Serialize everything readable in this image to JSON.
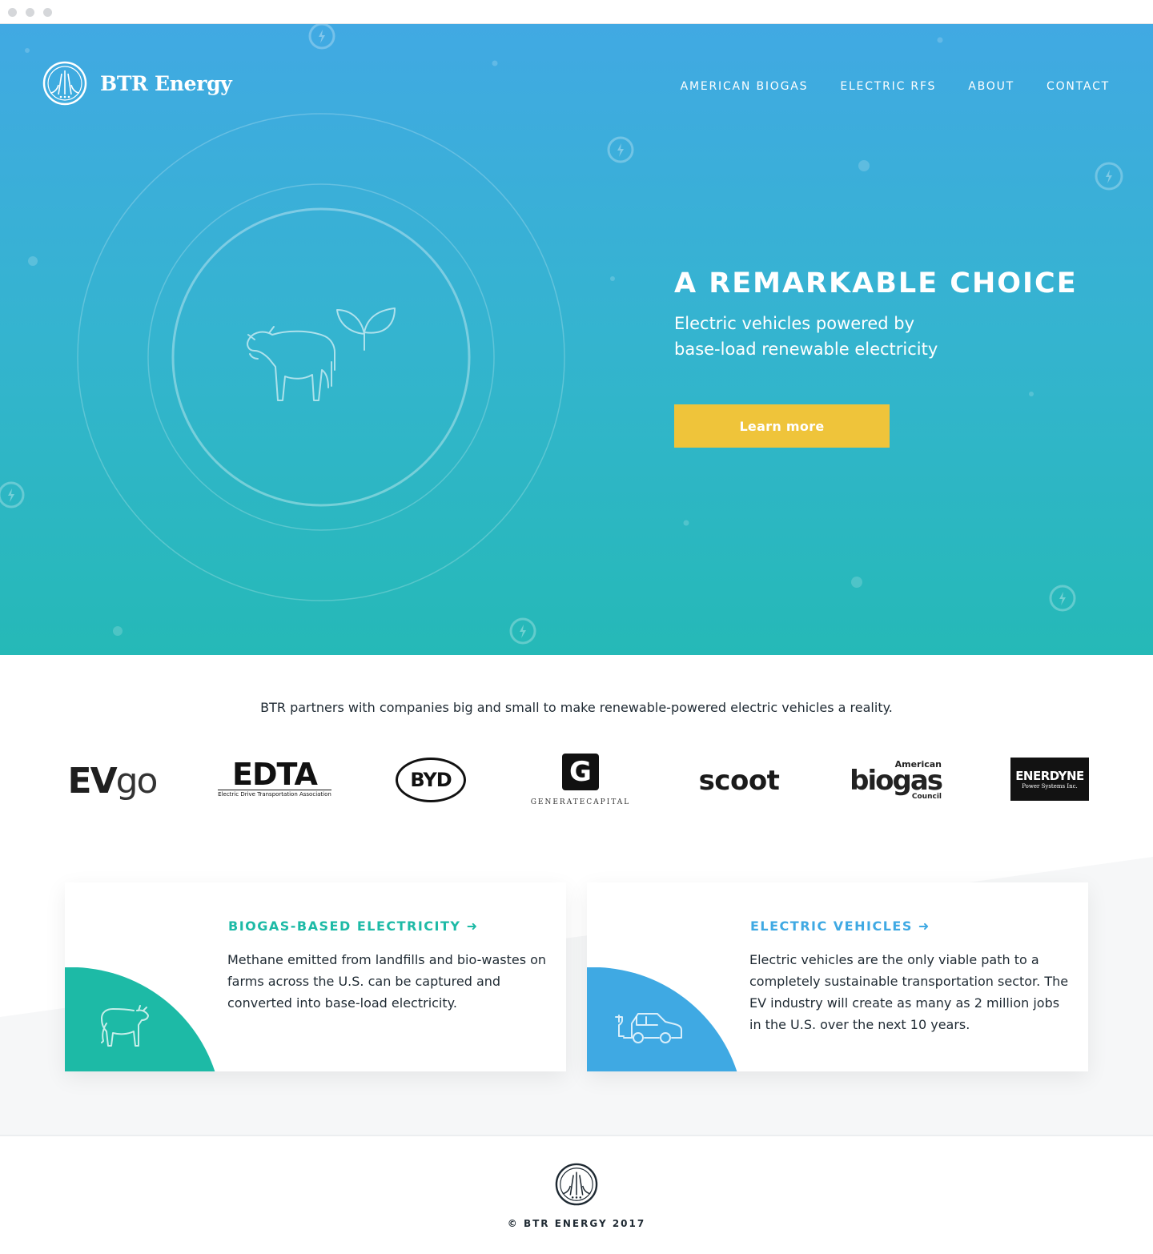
{
  "brand": {
    "name": "BTR Energy",
    "logo_icon": "btr-logo-icon"
  },
  "nav": {
    "items": [
      "AMERICAN BIOGAS",
      "ELECTRIC RFS",
      "ABOUT",
      "CONTACT"
    ]
  },
  "hero": {
    "title": "A REMARKABLE CHOICE",
    "subtitle_line1": "Electric vehicles powered by",
    "subtitle_line2": "base-load renewable electricity",
    "cta_label": "Learn more",
    "illustration_icons": [
      "cow-icon",
      "leaf-icon",
      "bolt-icon"
    ]
  },
  "partners": {
    "intro": "BTR partners with companies big and small to make renewable-powered electric vehicles a reality.",
    "logos": {
      "evgo": {
        "ev": "EV",
        "go": "go"
      },
      "edta": {
        "main": "EDTA",
        "tagline": "Electric Drive Transportation Association"
      },
      "byd": {
        "main": "BYD"
      },
      "generate": {
        "mark": "G",
        "word": "GENERATECAPITAL"
      },
      "scoot": {
        "main": "scoot"
      },
      "biogas": {
        "top": "American",
        "main": "biogas",
        "bottom": "Council"
      },
      "enerdyne": {
        "main": "ENERDYNE",
        "tagline": "Power Systems Inc."
      }
    }
  },
  "features": [
    {
      "title": "BIOGAS-BASED ELECTRICITY ➜",
      "body": "Methane emitted from landfills and bio-wastes on farms across the U.S. can be captured and converted into base-load electricity.",
      "accent": "#1dbaa6",
      "icon": "cow-icon"
    },
    {
      "title": "ELECTRIC VEHICLES ➜",
      "body": "Electric vehicles are the only viable path to a completely sustainable transportation sector. The EV industry will create as many as 2 million jobs in the U.S. over the next 10 years.",
      "accent": "#3fa9e3",
      "icon": "electric-car-icon"
    }
  ],
  "footer": {
    "copyright": "© BTR ENERGY 2017"
  },
  "colors": {
    "hero_top": "#41a9e3",
    "hero_bottom": "#25b9b7",
    "cta": "#efc43a",
    "teal": "#1dbaa6",
    "blue": "#3fa9e3"
  }
}
